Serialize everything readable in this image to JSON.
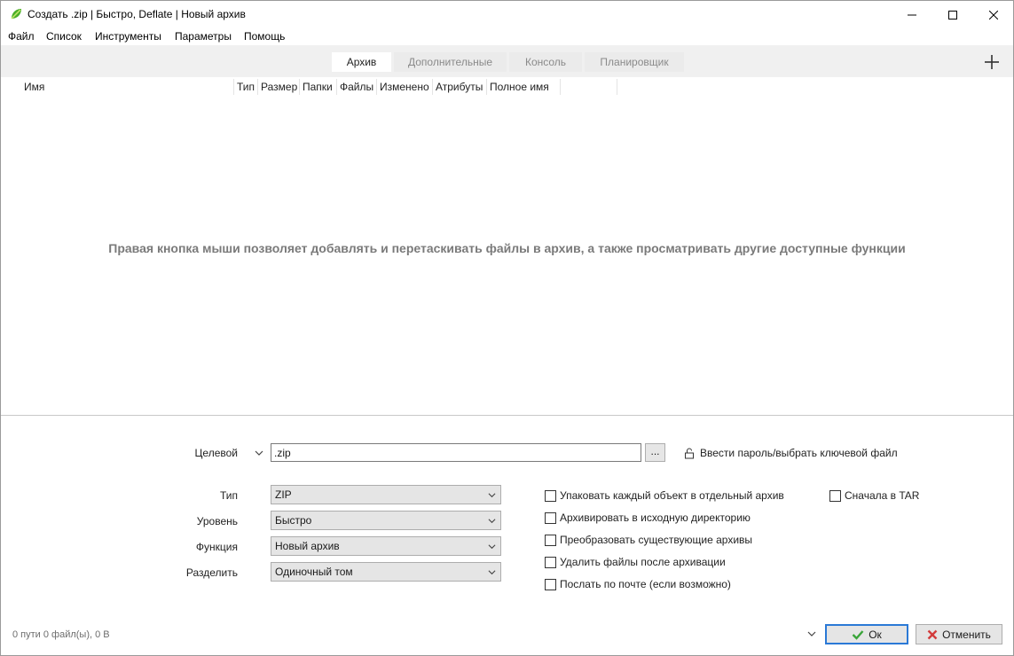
{
  "window": {
    "title": "Создать .zip | Быстро, Deflate | Новый архив"
  },
  "menu": [
    "Файл",
    "Список",
    "Инструменты",
    "Параметры",
    "Помощь"
  ],
  "tabs": [
    {
      "label": "Архив",
      "active": true
    },
    {
      "label": "Дополнительные",
      "active": false
    },
    {
      "label": "Консоль",
      "active": false
    },
    {
      "label": "Планировщик",
      "active": false
    }
  ],
  "columns": [
    "Имя",
    "Тип",
    "Размер",
    "Папки",
    "Файлы",
    "Изменено",
    "Атрибуты",
    "Полное имя"
  ],
  "list": {
    "hint": "Правая кнопка мыши позволяет добавлять и перетаскивать файлы в архив, а также просматривать другие доступные функции"
  },
  "target": {
    "label": "Целевой",
    "value": ".zip",
    "browse_label": "...",
    "password_label": "Ввести пароль/выбрать ключевой файл"
  },
  "options": {
    "type": {
      "label": "Тип",
      "value": "ZIP"
    },
    "level": {
      "label": "Уровень",
      "value": "Быстро"
    },
    "function": {
      "label": "Функция",
      "value": "Новый архив"
    },
    "split": {
      "label": "Разделить",
      "value": "Одиночный том"
    }
  },
  "checkboxes": [
    {
      "label": "Упаковать каждый объект в отдельный архив",
      "checked": false
    },
    {
      "label": "Архивировать в исходную директорию",
      "checked": false
    },
    {
      "label": "Преобразовать существующие архивы",
      "checked": false
    },
    {
      "label": "Удалить файлы после архивации",
      "checked": false
    },
    {
      "label": "Послать по почте (если возможно)",
      "checked": false
    },
    {
      "label": "Сначала в TAR",
      "checked": false
    }
  ],
  "status": {
    "text": "0 пути 0 файл(ы), 0 B"
  },
  "buttons": {
    "ok": "Ок",
    "cancel": "Отменить"
  },
  "colors": {
    "accent": "#2b79d6",
    "ok_check": "#3aa53a",
    "cancel_x": "#d23b3b",
    "app_icon": "#4caf2a"
  }
}
